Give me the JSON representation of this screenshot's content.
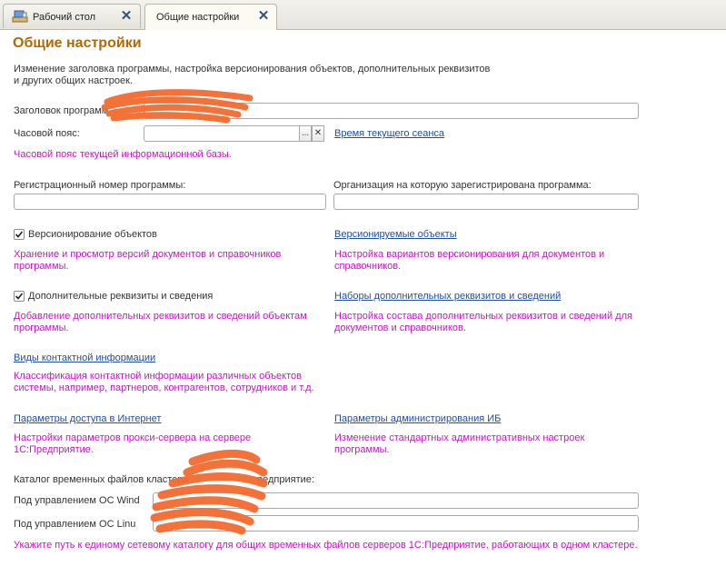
{
  "tabs": [
    {
      "label": "Рабочий стол",
      "icon": "desktop-icon"
    },
    {
      "label": "Общие настройки",
      "active": true
    }
  ],
  "page": {
    "title": "Общие настройки",
    "description_line1": "Изменение заголовка программы, настройка версионирования объектов, дополнительных реквизитов",
    "description_line2": "и других общих настроек."
  },
  "app_title": {
    "label": "Заголовок программ"
  },
  "timezone": {
    "label": "Часовой пояс:",
    "choose_button": "...",
    "clear_button": "✕",
    "session_time_link": "Время текущего сеанса",
    "hint": "Часовой пояс текущей информационной базы."
  },
  "registration": {
    "label": "Регистрационный номер программы:"
  },
  "organization": {
    "label": "Организация на которую зарегистрирована программа:"
  },
  "versioning": {
    "checkbox_label": "Версионирование объектов",
    "checked": true,
    "hint_line1": "Хранение и просмотр версий документов и справочников",
    "hint_line2": "программы.",
    "link": "Версионируемые объекты",
    "link_hint_line1": "Настройка вариантов версионирования для документов и",
    "link_hint_line2": "справочников."
  },
  "additional": {
    "checkbox_label": "Дополнительные реквизиты и сведения",
    "checked": true,
    "hint_line1": "Добавление дополнительных реквизитов и сведений объектам",
    "hint_line2": "программы.",
    "link": "Наборы дополнительных реквизитов и сведений",
    "link_hint_line1": "Настройка состава дополнительных реквизитов и сведений для",
    "link_hint_line2": "документов и справочников."
  },
  "contact_info": {
    "link": "Виды контактной информации",
    "hint_line1": "Классификация контактной информации различных объектов",
    "hint_line2": "системы, например, партнеров, контрагентов, сотрудников и т.д."
  },
  "internet": {
    "link": "Параметры доступа в Интернет",
    "hint_line1": "Настройки параметров прокси-сервера на сервере",
    "hint_line2": "1С:Предприятие."
  },
  "admin": {
    "link": "Параметры администрирования ИБ",
    "hint_line1": "Изменение стандартных административных настроек",
    "hint_line2": "программы."
  },
  "temp_catalog": {
    "label_left": "Каталог временных файлов кластера",
    "label_right": "редприятие:",
    "windows_label": "Под управлением ОС Wind",
    "linux_label": "Под управлением ОС Linu",
    "hint": "Укажите путь к единому сетевому каталогу для общих временных файлов серверов 1С:Предприятие, работающих в одном кластере."
  },
  "colors": {
    "title": "#b06a00",
    "hint": "#c516c5",
    "link": "#1f4ea0",
    "redaction": "#f26a2e"
  }
}
